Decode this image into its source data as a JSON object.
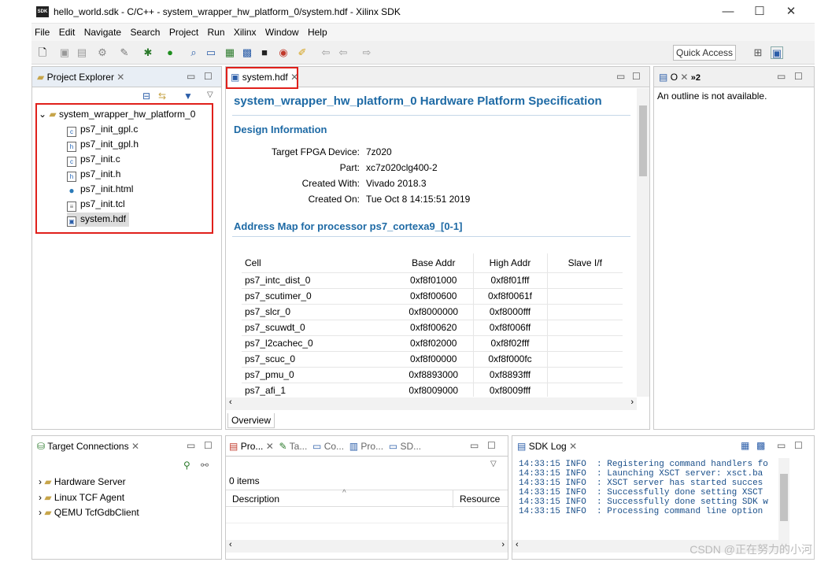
{
  "window": {
    "title": "hello_world.sdk - C/C++ - system_wrapper_hw_platform_0/system.hdf - Xilinx SDK",
    "app_icon": "SDK",
    "min": "—",
    "max": "☐",
    "close": "✕"
  },
  "menu": [
    "File",
    "Edit",
    "Navigate",
    "Search",
    "Project",
    "Run",
    "Xilinx",
    "Window",
    "Help"
  ],
  "toolbar": {
    "quick_access": "Quick Access"
  },
  "project_explorer": {
    "title": "Project Explorer",
    "root": "system_wrapper_hw_platform_0",
    "files": [
      {
        "name": "ps7_init_gpl.c",
        "icon": "c-file-icon",
        "glyph": "c"
      },
      {
        "name": "ps7_init_gpl.h",
        "icon": "h-file-icon",
        "glyph": "h"
      },
      {
        "name": "ps7_init.c",
        "icon": "c-file-icon",
        "glyph": "c"
      },
      {
        "name": "ps7_init.h",
        "icon": "h-file-icon",
        "glyph": "h"
      },
      {
        "name": "ps7_init.html",
        "icon": "web-file-icon",
        "glyph": "●"
      },
      {
        "name": "ps7_init.tcl",
        "icon": "text-file-icon",
        "glyph": "≡"
      },
      {
        "name": "system.hdf",
        "icon": "hdf-file-icon",
        "glyph": "▣"
      }
    ]
  },
  "editor": {
    "tab": "system.hdf",
    "heading": "system_wrapper_hw_platform_0 Hardware Platform Specification",
    "design_info_title": "Design Information",
    "design_info": [
      {
        "k": "Target FPGA Device:",
        "v": "7z020"
      },
      {
        "k": "Part:",
        "v": "xc7z020clg400-2"
      },
      {
        "k": "Created With:",
        "v": "Vivado 2018.3"
      },
      {
        "k": "Created On:",
        "v": "Tue Oct  8 14:15:51 2019"
      }
    ],
    "address_map_title": "Address Map for processor ps7_cortexa9_[0-1]",
    "columns": [
      "Cell",
      "Base Addr",
      "High Addr",
      "Slave I/f"
    ],
    "rows": [
      [
        "ps7_intc_dist_0",
        "0xf8f01000",
        "0xf8f01fff",
        ""
      ],
      [
        "ps7_scutimer_0",
        "0xf8f00600",
        "0xf8f0061f",
        ""
      ],
      [
        "ps7_slcr_0",
        "0xf8000000",
        "0xf8000fff",
        ""
      ],
      [
        "ps7_scuwdt_0",
        "0xf8f00620",
        "0xf8f006ff",
        ""
      ],
      [
        "ps7_l2cachec_0",
        "0xf8f02000",
        "0xf8f02fff",
        ""
      ],
      [
        "ps7_scuc_0",
        "0xf8f00000",
        "0xf8f000fc",
        ""
      ],
      [
        "ps7_pmu_0",
        "0xf8893000",
        "0xf8893fff",
        ""
      ],
      [
        "ps7_afi_1",
        "0xf8009000",
        "0xf8009fff",
        ""
      ]
    ],
    "bottom_tab": "Overview"
  },
  "outline": {
    "tab": "O",
    "overflow": "»2",
    "message": "An outline is not available."
  },
  "target_connections": {
    "title": "Target Connections",
    "items": [
      "Hardware Server",
      "Linux TCF Agent",
      "QEMU TcfGdbClient"
    ]
  },
  "problems": {
    "tabs": [
      "Pro...",
      "Ta...",
      "Co...",
      "Pro...",
      "SD..."
    ],
    "count": "0 items",
    "columns": [
      "Description",
      "Resource"
    ]
  },
  "sdk_log": {
    "title": "SDK Log",
    "lines": [
      {
        "time": "14:33:15",
        "level": "INFO",
        "msg": ": Registering command handlers fo"
      },
      {
        "time": "14:33:15",
        "level": "INFO",
        "msg": ": Launching XSCT server: xsct.ba"
      },
      {
        "time": "14:33:15",
        "level": "INFO",
        "msg": ": XSCT server has started succes"
      },
      {
        "time": "14:33:15",
        "level": "INFO",
        "msg": ": Successfully done setting XSCT"
      },
      {
        "time": "14:33:15",
        "level": "INFO",
        "msg": ": Successfully done setting SDK w"
      },
      {
        "time": "14:33:15",
        "level": "INFO",
        "msg": ": Processing command line option"
      }
    ]
  },
  "watermark": "CSDN @正在努力的小河"
}
